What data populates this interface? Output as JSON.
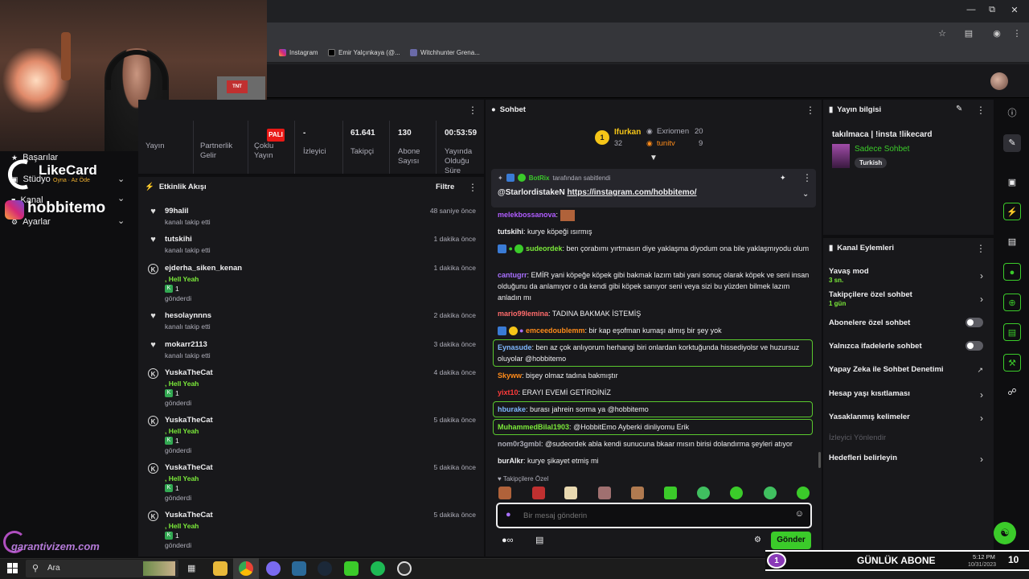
{
  "browser": {
    "bookmarks": [
      "Instagram",
      "Emir Yalçınkaya (@...",
      "Witchhunter Grena..."
    ]
  },
  "overlay": {
    "likecard_brand": "LikeCard",
    "likecard_slogan": "Oyna · Az Öde",
    "instagram_handle": "hobbitemo",
    "garanti_brand": "garantivizem.com"
  },
  "leftnav": {
    "items": [
      {
        "label": "Başarılar"
      },
      {
        "label": "Stüdyo"
      },
      {
        "label": "Kanal"
      },
      {
        "label": "Ayarlar"
      }
    ]
  },
  "stats": {
    "partial_badge": "PALI",
    "items": [
      {
        "value": "",
        "label": "Yayın"
      },
      {
        "value": "",
        "label": "Partnerlik Gelir"
      },
      {
        "value": "",
        "label": "Çoklu Yayın"
      },
      {
        "value": "-",
        "label": "İzleyici"
      },
      {
        "value": "61.641",
        "label": "Takipçi"
      },
      {
        "value": "130",
        "label": "Abone Sayısı"
      },
      {
        "value": "00:53:59",
        "label": "Yayında Olduğu Süre"
      }
    ]
  },
  "activity": {
    "title": "Etkinlik Akışı",
    "filter_label": "Filtre",
    "items": [
      {
        "type": "follow",
        "name": "99halil",
        "time": "48 saniye önce",
        "sub": "kanalı takip etti"
      },
      {
        "type": "follow",
        "name": "tutskihi",
        "time": "1 dakika önce",
        "sub": "kanalı takip etti"
      },
      {
        "type": "gift",
        "name": "ejderha_siken_kenan",
        "time": "1 dakika önce",
        "reward": ", Hell Yeah",
        "count": "1",
        "sub": "gönderdi"
      },
      {
        "type": "follow",
        "name": "hesolaynnns",
        "time": "2 dakika önce",
        "sub": "kanalı takip etti"
      },
      {
        "type": "follow",
        "name": "mokarr2113",
        "time": "3 dakika önce",
        "sub": "kanalı takip etti"
      },
      {
        "type": "gift",
        "name": "YuskaTheCat",
        "time": "4 dakika önce",
        "reward": ", Hell Yeah",
        "count": "1",
        "sub": "gönderdi"
      },
      {
        "type": "gift",
        "name": "YuskaTheCat",
        "time": "5 dakika önce",
        "reward": ", Hell Yeah",
        "count": "1",
        "sub": "gönderdi"
      },
      {
        "type": "gift",
        "name": "YuskaTheCat",
        "time": "5 dakika önce",
        "reward": ", Hell Yeah",
        "count": "1",
        "sub": "gönderdi"
      },
      {
        "type": "gift",
        "name": "YuskaTheCat",
        "time": "5 dakika önce",
        "reward": ", Hell Yeah",
        "count": "1",
        "sub": "gönderdi"
      }
    ]
  },
  "chat": {
    "title": "Sohbet",
    "leaderboard": [
      {
        "rank": "1",
        "name": "Ifurkan",
        "score": "32"
      },
      {
        "name": "Exriomen",
        "score": "20"
      },
      {
        "name": "tunitv",
        "score": "9"
      }
    ],
    "pinned": {
      "by_user": "BotRix",
      "by_text": "tarafından sabitlendi",
      "mention": "@StarlordistakeN",
      "link": "https://instagram.com/hobbitemo/"
    },
    "messages": [
      {
        "user": "melekbossanova",
        "color": "#b05cff",
        "text": ""
      },
      {
        "user": "tutskihi",
        "color": "#efeff1",
        "text": "kurye köpeği ısırmış"
      },
      {
        "user": "sudeordek",
        "color": "#7bea3a",
        "text": "ben çorabımı yırtmasın diye yaklaşma diyodum ona bile yaklaşmıyodu olum"
      },
      {
        "user": "cantugrr",
        "color": "#a970ff",
        "text": "EMİR yani köpeğe köpek gibi bakmak lazım tabi yani sonuç olarak köpek ve seni insan olduğunu da anlamıyor o da kendi gibi köpek sanıyor seni veya sizi bu yüzden bilmek lazım anladın mı"
      },
      {
        "user": "mario99lemina",
        "color": "#ff6b6b",
        "text": "TADINA BAKMAK İSTEMİŞ"
      },
      {
        "user": "emceedoublemm",
        "color": "#ff8c1a",
        "text": "bir kap eşofman kumaşı almış bir şey yok"
      },
      {
        "user": "Eynasude",
        "color": "#7fb8ff",
        "text": "ben az çok anlıyorum herhangi biri onlardan korktuğunda hissediyolsr ve huzursuz oluyolar @hobbitemo"
      },
      {
        "user": "Skyww",
        "color": "#ff8c1a",
        "text": "bişey olmaz tadına bakmıştır"
      },
      {
        "user": "yixt10",
        "color": "#ff3b3b",
        "text": "ERAYI EVEMİ GETİRDİNİZ"
      },
      {
        "user": "hburake",
        "color": "#7fb8ff",
        "text": "burası jahrein sorma ya @hobbitemo"
      },
      {
        "user": "MuhammedBilal1903",
        "color": "#7bea3a",
        "text": "@HobbitEmo Ayberki dinliyomu Erik"
      },
      {
        "user": "nom0r3gmbl",
        "color": "#adadb8",
        "text": "@sudeordek abla kendi sunucuna bkaar mısın birisi dolandırma şeyleri atıyor"
      },
      {
        "user": "burAlkr",
        "color": "#efeff1",
        "text": "kurye şikayet etmiş mi"
      }
    ],
    "emote_section_label": "Takipçilere Özel",
    "input_placeholder": "Bir mesaj gönderin",
    "send_label": "Gönder"
  },
  "stream_info": {
    "title": "Yayın bilgisi",
    "stream_title": "takılmaca | !insta !likecard",
    "category": "Sadece Sohbet",
    "tag": "Turkish"
  },
  "channel_actions": {
    "title": "Kanal Eylemleri",
    "items": [
      {
        "label": "Yavaş mod",
        "sub": "3 sn.",
        "control": "chevron"
      },
      {
        "label": "Takipçilere özel sohbet",
        "sub": "1 gün",
        "control": "chevron"
      },
      {
        "label": "Abonelere özel sohbet",
        "sub": "",
        "control": "toggle"
      },
      {
        "label": "Yalnızca ifadelerle sohbet",
        "sub": "",
        "control": "toggle"
      },
      {
        "label": "Yapay Zeka ile Sohbet Denetimi",
        "sub": "",
        "control": "external"
      },
      {
        "label": "Hesap yaşı kısıtlaması",
        "sub": "",
        "control": "chevron"
      },
      {
        "label": "Yasaklanmış kelimeler",
        "sub": "",
        "control": "chevron"
      },
      {
        "label": "İzleyici Yönlendir",
        "sub": "",
        "control": "none"
      },
      {
        "label": "Hedefleri belirleyin",
        "sub": "",
        "control": "chevron"
      }
    ]
  },
  "taskbar": {
    "search_label": "Ara",
    "time": "5:12 PM",
    "date": "10/31/2023"
  },
  "sub_goal": {
    "current": "1",
    "label": "GÜNLÜK ABONE",
    "target": "10"
  },
  "colors": {
    "accent_green": "#3bcb2a",
    "panel_bg": "#18181b",
    "page_bg": "#0e0e10"
  }
}
